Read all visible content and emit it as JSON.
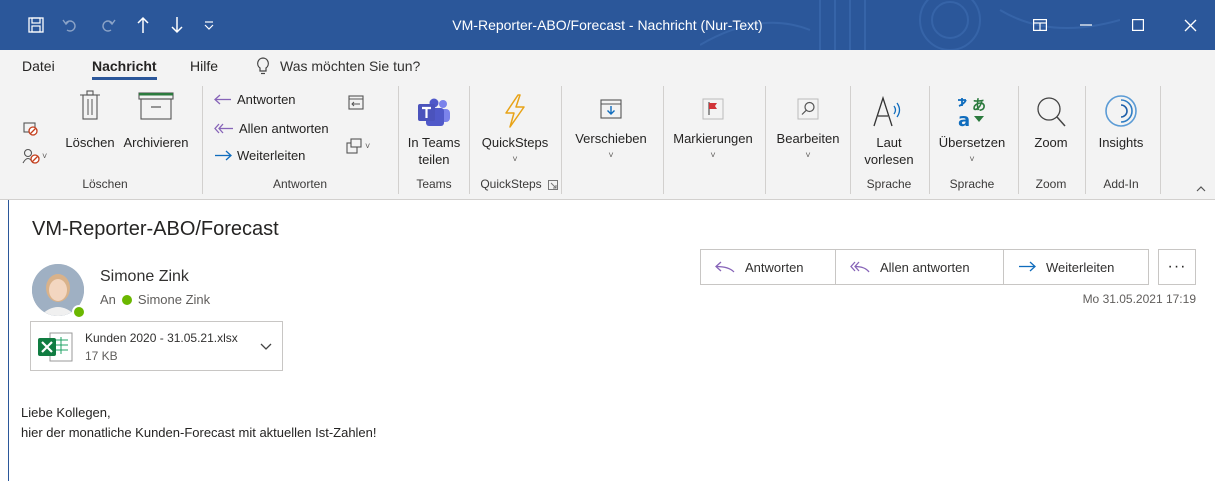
{
  "titlebar": {
    "title": "VM-Reporter-ABO/Forecast  -  Nachricht (Nur-Text)",
    "icons": [
      "save-icon",
      "undo-icon",
      "redo-icon",
      "previous-item-icon",
      "next-item-icon",
      "quick-access-customize-icon"
    ],
    "window_buttons": [
      "ribbon-display-options-icon",
      "minimize-icon",
      "maximize-icon",
      "close-icon"
    ],
    "accent_color": "#2b579a"
  },
  "menu": {
    "tabs": [
      "Datei",
      "Nachricht",
      "Hilfe"
    ],
    "active_tab": "Nachricht",
    "search_placeholder": "Was möchten Sie tun?"
  },
  "ribbon": {
    "loeschen": {
      "delete_label": "Löschen",
      "archive_label": "Archivieren",
      "group_label": "Löschen"
    },
    "antworten": {
      "reply": "Antworten",
      "reply_all": "Allen antworten",
      "forward": "Weiterleiten",
      "group_label": "Antworten"
    },
    "teams": {
      "share_label_1": "In Teams",
      "share_label_2": "teilen",
      "group_label": "Teams"
    },
    "quicksteps": {
      "label": "QuickSteps",
      "group_label": "QuickSteps"
    },
    "verschieben": {
      "label": "Verschieben"
    },
    "markierungen": {
      "label": "Markierungen"
    },
    "bearbeiten": {
      "label": "Bearbeiten"
    },
    "laut": {
      "label_1": "Laut",
      "label_2": "vorlesen",
      "group_label": "Sprache"
    },
    "uebersetzen": {
      "label": "Übersetzen",
      "group_label": "Sprache"
    },
    "zoom": {
      "label": "Zoom",
      "group_label": "Zoom"
    },
    "insights": {
      "label": "Insights",
      "group_label": "Add-In"
    }
  },
  "message": {
    "subject": "VM-Reporter-ABO/Forecast",
    "sender": "Simone Zink",
    "to_prefix": "An",
    "to_name": "Simone Zink",
    "date": "Mo 31.05.2021 17:19",
    "actions": {
      "reply": "Antworten",
      "reply_all": "Allen antworten",
      "forward": "Weiterleiten",
      "more": "···"
    },
    "attachment": {
      "name": "Kunden 2020 - 31.05.21.xlsx",
      "size": "17 KB"
    },
    "body": [
      "Liebe Kollegen,",
      "hier der monatliche Kunden-Forecast mit aktuellen Ist-Zahlen!"
    ]
  }
}
